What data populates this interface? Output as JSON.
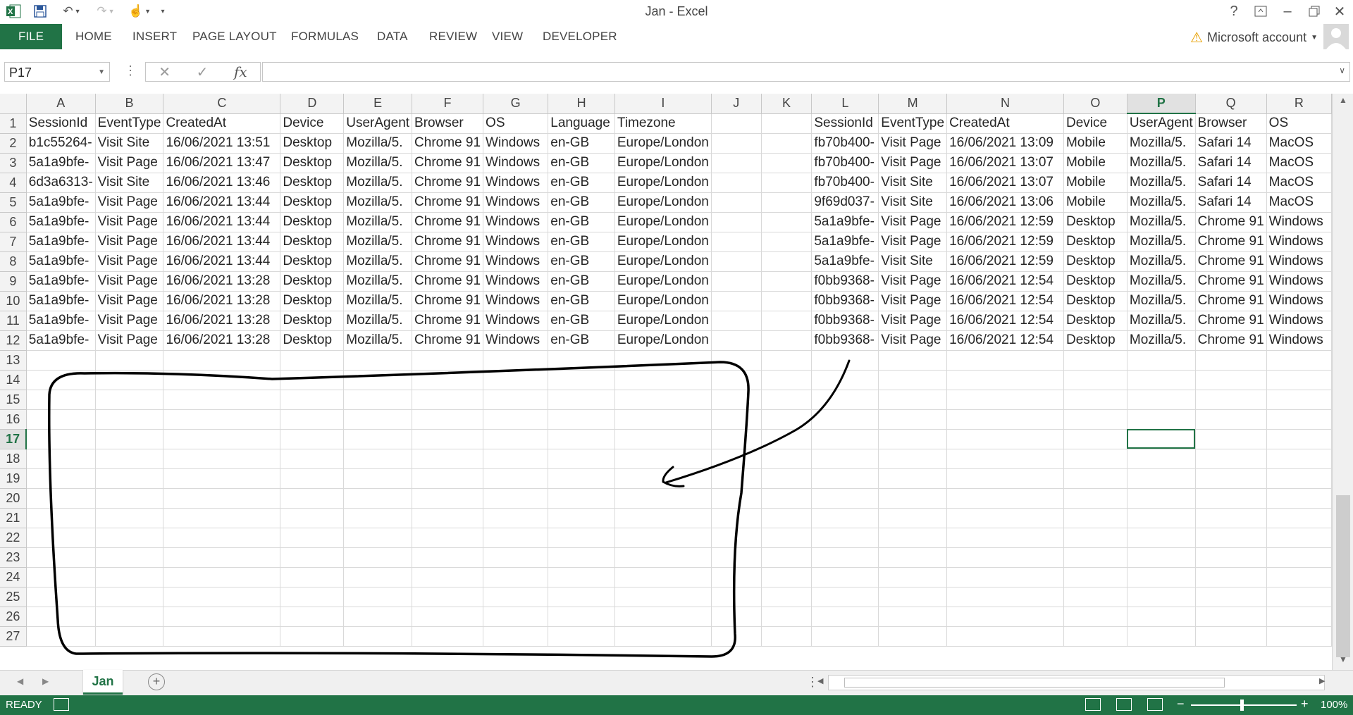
{
  "window": {
    "title": "Jan - Excel"
  },
  "ribbon": {
    "file": "FILE",
    "tabs": [
      "HOME",
      "INSERT",
      "PAGE LAYOUT",
      "FORMULAS",
      "DATA",
      "REVIEW",
      "VIEW",
      "DEVELOPER"
    ],
    "account": "Microsoft account"
  },
  "formula_bar": {
    "name_box": "P17",
    "fx": "fx",
    "value": ""
  },
  "sheet": {
    "columns": [
      "A",
      "B",
      "C",
      "D",
      "E",
      "F",
      "G",
      "H",
      "I",
      "J",
      "K",
      "L",
      "M",
      "N",
      "O",
      "P",
      "Q",
      "R"
    ],
    "selected_column": "P",
    "selected_row": 17,
    "active_cell": "P17",
    "rows": [
      [
        "SessionId",
        "EventType",
        "CreatedAt",
        "Device",
        "UserAgent",
        "Browser",
        "OS",
        "Language",
        "Timezone",
        "",
        "",
        "SessionId",
        "EventType",
        "CreatedAt",
        "Device",
        "UserAgent",
        "Browser",
        "OS"
      ],
      [
        "b1c55264-",
        "Visit Site",
        "16/06/2021 13:51",
        "Desktop",
        "Mozilla/5.",
        "Chrome 91",
        "Windows",
        "en-GB",
        "Europe/London",
        "",
        "",
        "fb70b400-",
        "Visit Page",
        "16/06/2021 13:09",
        "Mobile",
        "Mozilla/5.",
        "Safari 14",
        "MacOS"
      ],
      [
        "5a1a9bfe-",
        "Visit Page",
        "16/06/2021 13:47",
        "Desktop",
        "Mozilla/5.",
        "Chrome 91",
        "Windows",
        "en-GB",
        "Europe/London",
        "",
        "",
        "fb70b400-",
        "Visit Page",
        "16/06/2021 13:07",
        "Mobile",
        "Mozilla/5.",
        "Safari 14",
        "MacOS"
      ],
      [
        "6d3a6313-",
        "Visit Site",
        "16/06/2021 13:46",
        "Desktop",
        "Mozilla/5.",
        "Chrome 91",
        "Windows",
        "en-GB",
        "Europe/London",
        "",
        "",
        "fb70b400-",
        "Visit Site",
        "16/06/2021 13:07",
        "Mobile",
        "Mozilla/5.",
        "Safari 14",
        "MacOS"
      ],
      [
        "5a1a9bfe-",
        "Visit Page",
        "16/06/2021 13:44",
        "Desktop",
        "Mozilla/5.",
        "Chrome 91",
        "Windows",
        "en-GB",
        "Europe/London",
        "",
        "",
        "9f69d037-",
        "Visit Site",
        "16/06/2021 13:06",
        "Mobile",
        "Mozilla/5.",
        "Safari 14",
        "MacOS"
      ],
      [
        "5a1a9bfe-",
        "Visit Page",
        "16/06/2021 13:44",
        "Desktop",
        "Mozilla/5.",
        "Chrome 91",
        "Windows",
        "en-GB",
        "Europe/London",
        "",
        "",
        "5a1a9bfe-",
        "Visit Page",
        "16/06/2021 12:59",
        "Desktop",
        "Mozilla/5.",
        "Chrome 91",
        "Windows"
      ],
      [
        "5a1a9bfe-",
        "Visit Page",
        "16/06/2021 13:44",
        "Desktop",
        "Mozilla/5.",
        "Chrome 91",
        "Windows",
        "en-GB",
        "Europe/London",
        "",
        "",
        "5a1a9bfe-",
        "Visit Page",
        "16/06/2021 12:59",
        "Desktop",
        "Mozilla/5.",
        "Chrome 91",
        "Windows"
      ],
      [
        "5a1a9bfe-",
        "Visit Page",
        "16/06/2021 13:44",
        "Desktop",
        "Mozilla/5.",
        "Chrome 91",
        "Windows",
        "en-GB",
        "Europe/London",
        "",
        "",
        "5a1a9bfe-",
        "Visit Site",
        "16/06/2021 12:59",
        "Desktop",
        "Mozilla/5.",
        "Chrome 91",
        "Windows"
      ],
      [
        "5a1a9bfe-",
        "Visit Page",
        "16/06/2021 13:28",
        "Desktop",
        "Mozilla/5.",
        "Chrome 91",
        "Windows",
        "en-GB",
        "Europe/London",
        "",
        "",
        "f0bb9368-",
        "Visit Page",
        "16/06/2021 12:54",
        "Desktop",
        "Mozilla/5.",
        "Chrome 91",
        "Windows"
      ],
      [
        "5a1a9bfe-",
        "Visit Page",
        "16/06/2021 13:28",
        "Desktop",
        "Mozilla/5.",
        "Chrome 91",
        "Windows",
        "en-GB",
        "Europe/London",
        "",
        "",
        "f0bb9368-",
        "Visit Page",
        "16/06/2021 12:54",
        "Desktop",
        "Mozilla/5.",
        "Chrome 91",
        "Windows"
      ],
      [
        "5a1a9bfe-",
        "Visit Page",
        "16/06/2021 13:28",
        "Desktop",
        "Mozilla/5.",
        "Chrome 91",
        "Windows",
        "en-GB",
        "Europe/London",
        "",
        "",
        "f0bb9368-",
        "Visit Page",
        "16/06/2021 12:54",
        "Desktop",
        "Mozilla/5.",
        "Chrome 91",
        "Windows"
      ],
      [
        "5a1a9bfe-",
        "Visit Page",
        "16/06/2021 13:28",
        "Desktop",
        "Mozilla/5.",
        "Chrome 91",
        "Windows",
        "en-GB",
        "Europe/London",
        "",
        "",
        "f0bb9368-",
        "Visit Page",
        "16/06/2021 12:54",
        "Desktop",
        "Mozilla/5.",
        "Chrome 91",
        "Windows"
      ]
    ],
    "total_rows": 27,
    "tab": "Jan"
  },
  "status_bar": {
    "mode": "READY",
    "zoom": "100%"
  },
  "colors": {
    "accent": "#217346",
    "annotation_ink": "#000000"
  }
}
